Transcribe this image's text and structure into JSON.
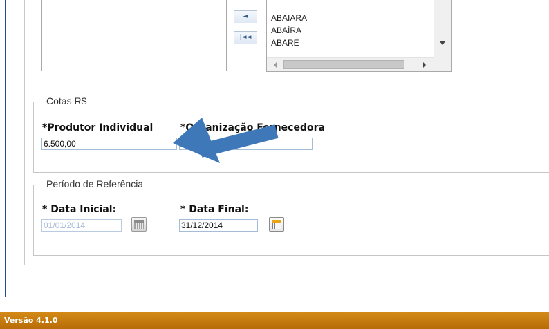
{
  "transfer_buttons": [
    {
      "icon": "move-left-icon",
      "glyph": "◄"
    },
    {
      "icon": "move-all-left-icon",
      "glyph": "|◄◄"
    }
  ],
  "city_list": {
    "items": [
      "ABAIARA",
      "ABAÍRA",
      "ABARÉ"
    ]
  },
  "cotas": {
    "legend": "Cotas R$",
    "produtor_label": "*Produtor Individual",
    "produtor_value": "6.500,00",
    "organizacao_label": "*Organização Fornecedora",
    "organizacao_value": "...00"
  },
  "periodo": {
    "legend": "Período de Referência",
    "data_inicial_label": "* Data Inicial:",
    "data_inicial_value": "01/01/2014",
    "data_final_label": "* Data Final:",
    "data_final_value": "31/12/2014"
  },
  "footer": {
    "version": "Versão 4.1.0"
  },
  "colors": {
    "footer_bg": "#c47a10",
    "annotation_arrow": "#3e78b8"
  }
}
